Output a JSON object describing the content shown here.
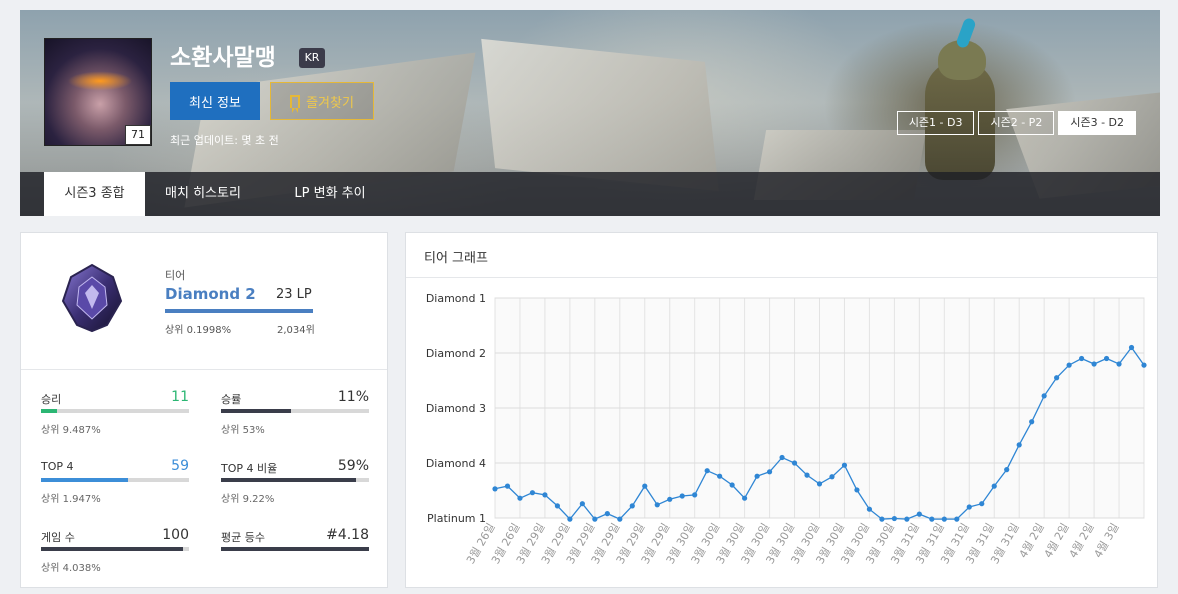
{
  "profile": {
    "name": "소환사말맹",
    "region": "KR",
    "level": "71",
    "refresh_label": "최신 정보",
    "favorite_label": "즐겨찾기",
    "updated_text": "최근 업데이트: 몇 초 전",
    "seasons": [
      "시즌1 - D3",
      "시즌2 - P2",
      "시즌3 - D2"
    ]
  },
  "tabs": [
    "시즌3 종합",
    "매치 히스토리",
    "LP 변화 추이"
  ],
  "tier": {
    "label": "티어",
    "name": "Diamond 2",
    "lp": "23 LP",
    "top_percent": "상위 0.1998%",
    "rank": "2,034위"
  },
  "stats": [
    {
      "label": "승리",
      "value": "11",
      "sub": "상위 9.487%",
      "fill": 0.11,
      "color": "#2bb673"
    },
    {
      "label": "승률",
      "value": "11%",
      "sub": "상위 53%",
      "fill": 0.47,
      "color": "#3a3d4a"
    },
    {
      "label": "TOP 4",
      "value": "59",
      "sub": "상위 1.947%",
      "fill": 0.59,
      "color": "#3c8ed8"
    },
    {
      "label": "TOP 4 비율",
      "value": "59%",
      "sub": "상위 9.22%",
      "fill": 0.91,
      "color": "#3a3d4a"
    },
    {
      "label": "게임 수",
      "value": "100",
      "sub": "상위 4.038%",
      "fill": 0.96,
      "color": "#3a3d4a"
    },
    {
      "label": "평균 등수",
      "value": "#4.18",
      "sub": "",
      "fill": 1.0,
      "color": "#3a3d4a"
    }
  ],
  "colors": {
    "accent": "#1f6fbf",
    "favorite": "#e5b838",
    "tier_blue": "#4a7fc1",
    "line": "#2f86d4"
  },
  "chart": {
    "title": "티어 그래프"
  },
  "chart_data": {
    "type": "line",
    "title": "",
    "xlabel": "",
    "ylabel": "",
    "y_ticks": [
      "Diamond 1",
      "Diamond 2",
      "Diamond 3",
      "Diamond 4",
      "Platinum 1"
    ],
    "ylim": [
      0,
      4
    ],
    "x": [
      "3월 26일",
      "3월 26일",
      "3월 26일",
      "3월 28일",
      "3월 29일",
      "3월 29일",
      "3월 29일",
      "3월 29일",
      "3월 29일",
      "3월 29일",
      "3월 29일",
      "3월 29일",
      "3월 29일",
      "3월 29일",
      "3월 29일",
      "3월 29일",
      "3월 30일",
      "3월 30일",
      "3월 30일",
      "3월 30일",
      "3월 30일",
      "3월 30일",
      "3월 30일",
      "3월 30일",
      "3월 30일",
      "3월 30일",
      "3월 30일",
      "3월 30일",
      "3월 30일",
      "3월 30일",
      "3월 30일",
      "3월 30일",
      "3월 30일",
      "3월 31일",
      "3월 31일",
      "3월 31일",
      "3월 31일",
      "3월 31일",
      "3월 31일",
      "3월 31일",
      "3월 31일",
      "3월 31일",
      "3월 31일",
      "4월 2일",
      "4월 2일",
      "4월 2일",
      "4월 2일",
      "4월 2일",
      "4월 2일",
      "4월 3일",
      "4월 3일",
      "4월 3일"
    ],
    "values": [
      1.47,
      1.42,
      1.64,
      1.54,
      1.58,
      1.78,
      2.02,
      1.74,
      2.02,
      1.92,
      2.02,
      1.78,
      1.42,
      1.76,
      1.66,
      1.6,
      1.58,
      1.14,
      1.24,
      1.4,
      1.64,
      1.24,
      1.16,
      0.9,
      1.0,
      1.22,
      1.38,
      1.25,
      1.04,
      1.49,
      1.84,
      2.02,
      2.01,
      2.02,
      1.93,
      2.02,
      2.02,
      2.02,
      1.8,
      1.74,
      1.42,
      1.12,
      0.67,
      0.25,
      -0.22,
      -0.55,
      -0.78,
      -0.9,
      -0.8,
      -0.9,
      -0.8,
      -1.1,
      -0.78
    ]
  }
}
